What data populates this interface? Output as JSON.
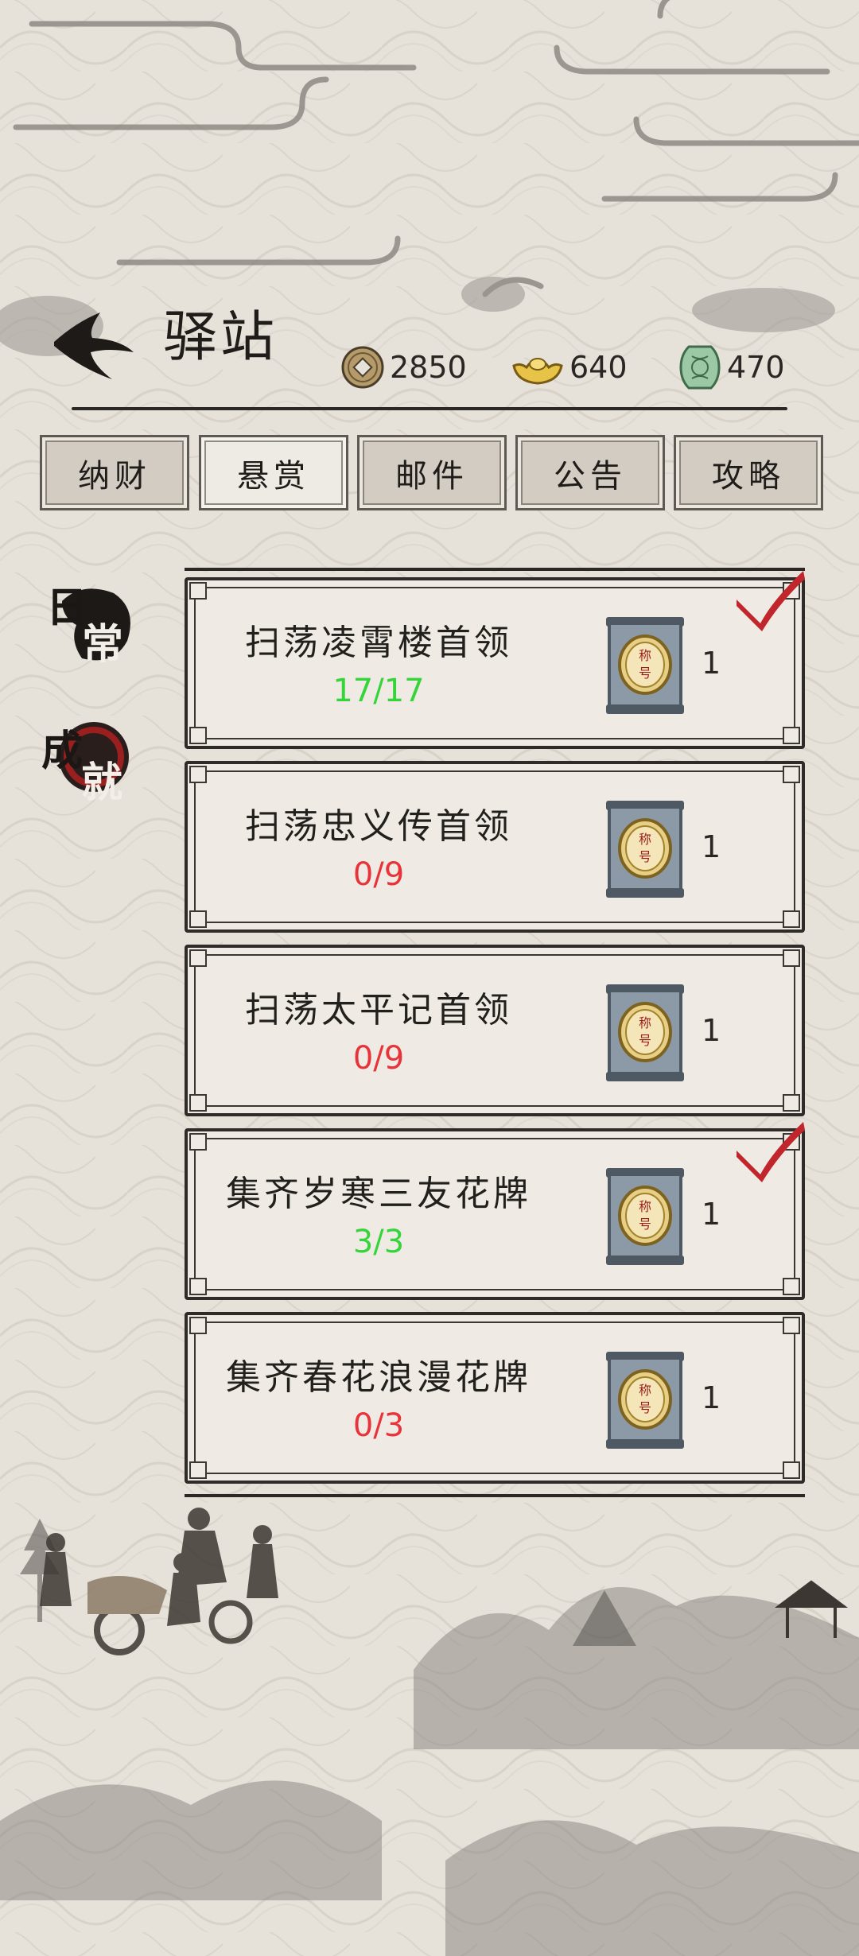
{
  "header": {
    "title": "驿站"
  },
  "currencies": [
    {
      "name": "copper-coin",
      "value": "2850"
    },
    {
      "name": "gold-ingot",
      "value": "640"
    },
    {
      "name": "jade-token",
      "value": "470"
    }
  ],
  "tabs": [
    {
      "label": "纳财",
      "active": false
    },
    {
      "label": "悬赏",
      "active": true
    },
    {
      "label": "邮件",
      "active": false
    },
    {
      "label": "公告",
      "active": false
    },
    {
      "label": "攻略",
      "active": false
    }
  ],
  "side_tabs": [
    {
      "chars": [
        "日",
        "常"
      ],
      "active": true
    },
    {
      "chars": [
        "成",
        "就"
      ],
      "active": false
    }
  ],
  "quests": [
    {
      "title": "扫荡凌霄楼首领",
      "progress": "17/17",
      "completed": true,
      "reward_icon": "title-scroll-icon",
      "reward_seal": "称号",
      "reward_count": "1"
    },
    {
      "title": "扫荡忠义传首领",
      "progress": "0/9",
      "completed": false,
      "reward_icon": "title-scroll-icon",
      "reward_seal": "称号",
      "reward_count": "1"
    },
    {
      "title": "扫荡太平记首领",
      "progress": "0/9",
      "completed": false,
      "reward_icon": "title-scroll-icon",
      "reward_seal": "称号",
      "reward_count": "1"
    },
    {
      "title": "集齐岁寒三友花牌",
      "progress": "3/3",
      "completed": true,
      "reward_icon": "title-scroll-icon",
      "reward_seal": "称号",
      "reward_count": "1"
    },
    {
      "title": "集齐春花浪漫花牌",
      "progress": "0/3",
      "completed": false,
      "reward_icon": "title-scroll-icon",
      "reward_seal": "称号",
      "reward_count": "1"
    }
  ],
  "colors": {
    "progress_done": "#35d43b",
    "progress_todo": "#e8333a",
    "check": "#c0262b",
    "accent_seal": "#9a1f1f"
  }
}
